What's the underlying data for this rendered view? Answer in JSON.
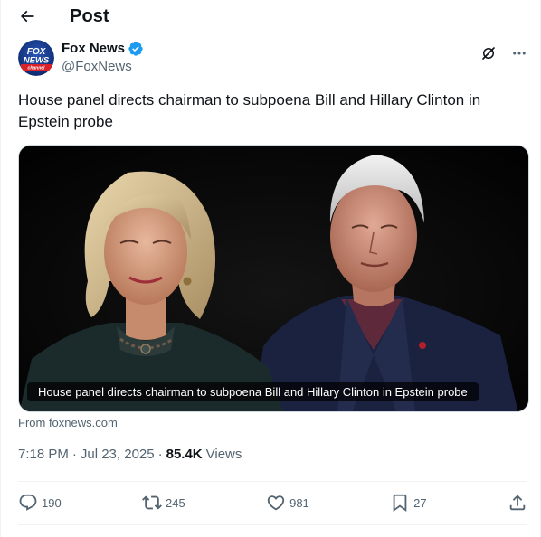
{
  "header": {
    "title": "Post",
    "back_icon": "arrow-left-icon"
  },
  "author": {
    "name": "Fox News",
    "handle": "@FoxNews",
    "verified": true,
    "verified_color": "#1d9bf0",
    "avatar_logo": {
      "line1": "FOX",
      "line2": "NEWS",
      "line3": "channel"
    },
    "actions": [
      {
        "icon": "grok-icon"
      },
      {
        "icon": "more-options-icon"
      }
    ]
  },
  "post": {
    "text": "House panel directs chairman to subpoena Bill and Hillary Clinton in Epstein probe",
    "card": {
      "caption": "House panel directs chairman to subpoena Bill and Hillary Clinton in Epstein probe",
      "source": "From foxnews.com"
    },
    "time": "7:18 PM",
    "date": "Jul 23, 2025",
    "views_count": "85.4K",
    "views_label": "Views"
  },
  "engagement": {
    "replies": "190",
    "reposts": "245",
    "likes": "981",
    "bookmarks": "27"
  },
  "colors": {
    "text_primary": "#0f1419",
    "text_secondary": "#536471",
    "border": "#eff3f4",
    "fox_red": "#d8232a",
    "fox_blue": "#1a3a8a"
  }
}
